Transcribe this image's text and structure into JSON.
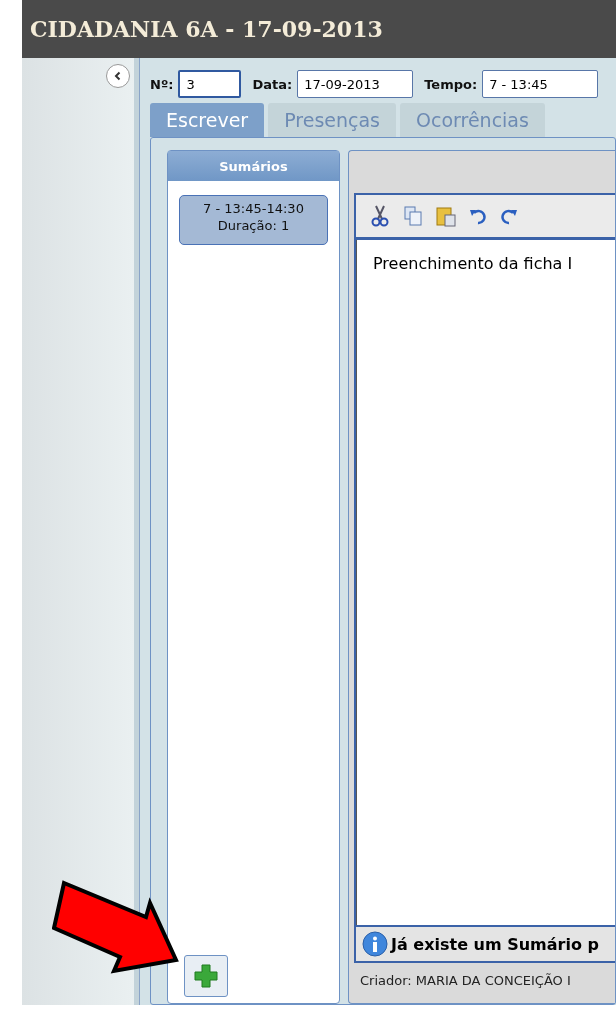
{
  "window": {
    "title": "CIDADANIA 6A - 17-09-2013"
  },
  "fields": [
    {
      "label": "Nº:",
      "value": "3",
      "focused": true
    },
    {
      "label": "Data:",
      "value": "17-09-2013",
      "focused": false
    },
    {
      "label": "Tempo:",
      "value": "7 - 13:45",
      "focused": false
    }
  ],
  "tabs": [
    {
      "label": "Escrever",
      "selected": true
    },
    {
      "label": "Presenças",
      "selected": false
    },
    {
      "label": "Ocorrências",
      "selected": false
    }
  ],
  "summaries": {
    "title": "Sumários",
    "items": [
      {
        "time": "7 - 13:45-14:30",
        "duration": "Duração: 1",
        "selected": true
      }
    ]
  },
  "editor": {
    "text": "Preenchimento da ficha I"
  },
  "info": "Já existe um Sumário p",
  "creator": "Criador: MARIA DA CONCEIÇÃO I"
}
